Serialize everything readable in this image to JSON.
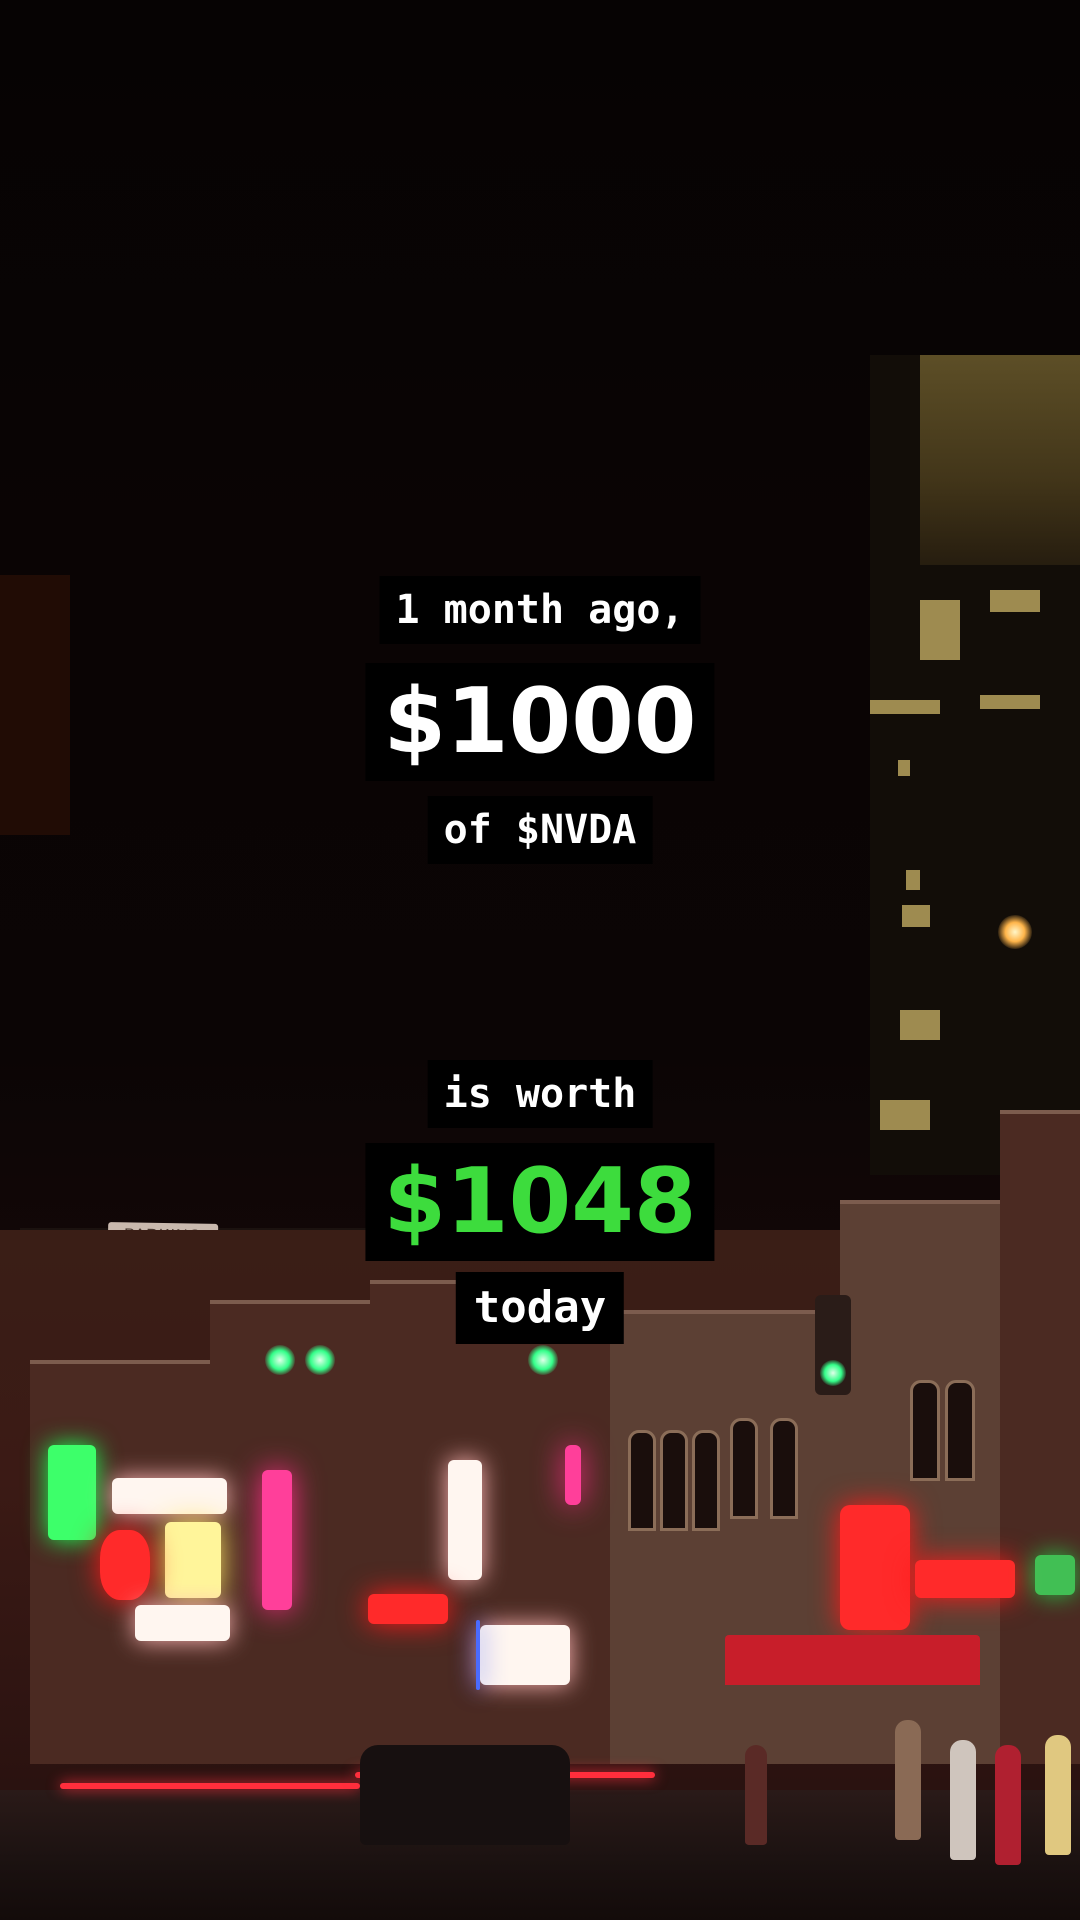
{
  "overlay": {
    "line1": "1 month ago,",
    "amount_start": "$1000",
    "line3": "of $NVDA",
    "line4": "is worth",
    "amount_end": "$1048",
    "line6": "today"
  },
  "scene": {
    "parking_sign": "PARKING"
  },
  "colors": {
    "gain": "#3ddc3d",
    "caption_bg": "#000000",
    "caption_text": "#ffffff"
  }
}
